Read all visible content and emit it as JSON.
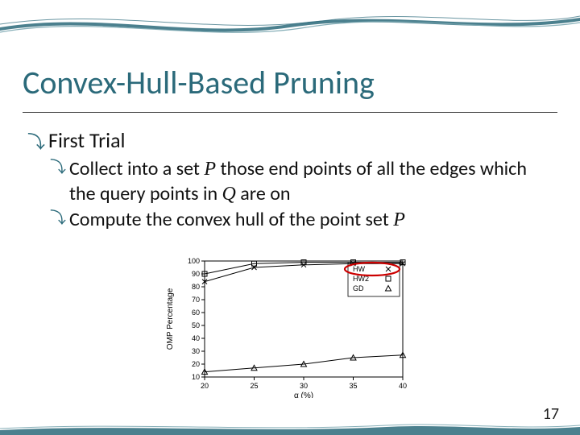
{
  "title": "Convex-Hull-Based Pruning",
  "page_number": "17",
  "bullets": {
    "first_trial": "First Trial",
    "collect_pre": "Collect into a set ",
    "collect_P": "P",
    "collect_mid": " those end points of all the edges which the query points in ",
    "collect_Q": "Q",
    "collect_post": " are on",
    "compute_pre": "Compute the convex hull of the point set ",
    "compute_P": "P"
  },
  "chart_data": {
    "type": "line",
    "title": "",
    "xlabel": "α (%)",
    "ylabel": "OMP Percentage",
    "x": [
      20,
      25,
      30,
      35,
      40
    ],
    "yticks": [
      10,
      20,
      30,
      40,
      50,
      60,
      70,
      80,
      90,
      100
    ],
    "xlim": [
      20,
      40
    ],
    "ylim": [
      10,
      100
    ],
    "series": [
      {
        "name": "HW",
        "marker": "x",
        "values": [
          84,
          95,
          97,
          98,
          98
        ]
      },
      {
        "name": "HW2",
        "marker": "square",
        "values": [
          90,
          98,
          99,
          99,
          99
        ]
      },
      {
        "name": "GD",
        "marker": "triangle",
        "values": [
          14,
          17,
          20,
          25,
          27
        ]
      }
    ],
    "legend_position": "top-right",
    "highlight_ellipse": {
      "text_around": "HW legend row"
    }
  }
}
